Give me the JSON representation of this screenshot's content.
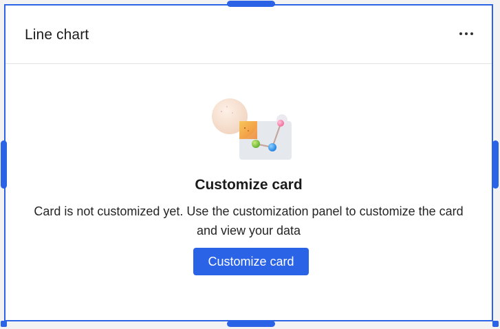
{
  "card": {
    "title": "Line chart",
    "more_options_icon": "ellipsis-horizontal-icon"
  },
  "empty_state": {
    "illustration": "chart-customize-illustration",
    "title": "Customize card",
    "description": "Card is not customized yet. Use the customization panel to customize the card and view your data",
    "button_label": "Customize card"
  },
  "colors": {
    "accent": "#2a63e6",
    "text": "#1b1b1b",
    "divider": "#e3e3e3"
  }
}
